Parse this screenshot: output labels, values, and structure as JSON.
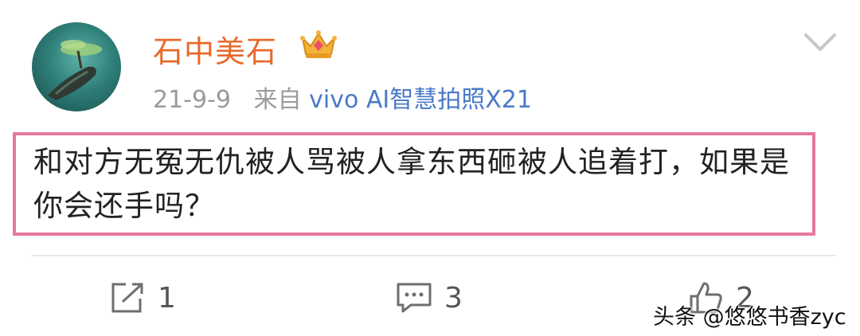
{
  "post": {
    "username": "石中美石",
    "date": "21-9-9",
    "source_prefix": "来自",
    "source": "vivo AI智慧拍照X21",
    "content": "和对方无冤无仇被人骂被人拿东西砸被人追着打，如果是你会还手吗？"
  },
  "actions": {
    "repost_count": "1",
    "comment_count": "3",
    "like_count": "2"
  },
  "watermark": "头条 @悠悠书香zyc",
  "icons": [
    "avatar",
    "crown-badge-icon",
    "chevron-down-icon",
    "repost-icon",
    "comment-icon",
    "like-icon"
  ],
  "colors": {
    "username": "#e8692b",
    "source": "#4a79c7",
    "highlight_border": "#e6799b"
  }
}
